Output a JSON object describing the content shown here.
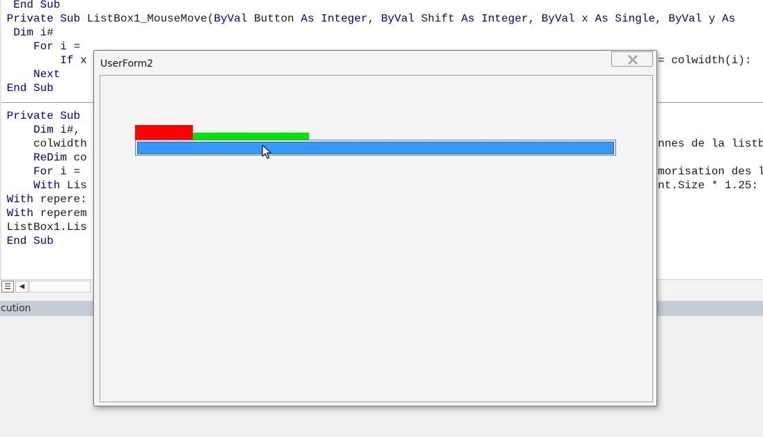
{
  "editor": {
    "code_lines": [
      {
        "segments": [
          {
            "t": "  End Sub",
            "c": "kw"
          }
        ]
      },
      {
        "segments": [
          {
            "t": " Private Sub ",
            "c": "kw"
          },
          {
            "t": "ListBox1_MouseMove(",
            "c": ""
          },
          {
            "t": "ByVal",
            "c": "kw"
          },
          {
            "t": " Button ",
            "c": ""
          },
          {
            "t": "As Integer",
            "c": "kw"
          },
          {
            "t": ", ",
            "c": ""
          },
          {
            "t": "ByVal",
            "c": "kw"
          },
          {
            "t": " Shift ",
            "c": ""
          },
          {
            "t": "As Integer",
            "c": "kw"
          },
          {
            "t": ", ",
            "c": ""
          },
          {
            "t": "ByVal",
            "c": "kw"
          },
          {
            "t": " x ",
            "c": ""
          },
          {
            "t": "As Single",
            "c": "kw"
          },
          {
            "t": ", ",
            "c": ""
          },
          {
            "t": "ByVal",
            "c": "kw"
          },
          {
            "t": " y ",
            "c": ""
          },
          {
            "t": "As",
            "c": "kw"
          }
        ]
      },
      {
        "segments": [
          {
            "t": "  Dim",
            "c": "kw"
          },
          {
            "t": " i#",
            "c": ""
          }
        ]
      },
      {
        "segments": [
          {
            "t": "     For",
            "c": "kw"
          },
          {
            "t": " i = ",
            "c": ""
          }
        ]
      },
      {
        "segments": [
          {
            "t": "         If",
            "c": "kw"
          },
          {
            "t": " x",
            "c": ""
          }
        ]
      },
      {
        "segments": [
          {
            "t": "     Next",
            "c": "kw"
          }
        ]
      },
      {
        "segments": [
          {
            "t": " End Sub",
            "c": "kw"
          }
        ]
      },
      {
        "segments": [
          {
            "t": "",
            "c": ""
          }
        ]
      },
      {
        "segments": [
          {
            "t": " Private Sub",
            "c": "kw"
          }
        ]
      },
      {
        "segments": [
          {
            "t": "     Dim",
            "c": "kw"
          },
          {
            "t": " i#,",
            "c": ""
          }
        ]
      },
      {
        "segments": [
          {
            "t": "     colwidth",
            "c": ""
          }
        ]
      },
      {
        "segments": [
          {
            "t": "     ReDim",
            "c": "kw"
          },
          {
            "t": " co",
            "c": ""
          }
        ]
      },
      {
        "segments": [
          {
            "t": "     For",
            "c": "kw"
          },
          {
            "t": " i = ",
            "c": ""
          }
        ]
      },
      {
        "segments": [
          {
            "t": "     With",
            "c": "kw"
          },
          {
            "t": " Lis",
            "c": ""
          }
        ]
      },
      {
        "segments": [
          {
            "t": " With",
            "c": "kw"
          },
          {
            "t": " repere:",
            "c": ""
          }
        ]
      },
      {
        "segments": [
          {
            "t": " With",
            "c": "kw"
          },
          {
            "t": " reperem",
            "c": ""
          }
        ]
      },
      {
        "segments": [
          {
            "t": " ListBox1.Lis",
            "c": ""
          }
        ]
      },
      {
        "segments": [
          {
            "t": " End Sub",
            "c": "kw"
          }
        ]
      }
    ],
    "right_fragments": [
      {
        "row": 4,
        "text": "= colwidth(i):",
        "c": ""
      },
      {
        "row": 10,
        "text": "nnes de la listb",
        "c": "cm"
      },
      {
        "row": 12,
        "text": "morisation des l",
        "c": "cm"
      },
      {
        "row": 13,
        "text": "nt.Size * 1.25:",
        "c": ""
      }
    ],
    "view_icon": "procedure-view-icon",
    "scroll_left_icon": "arrow-left-icon",
    "exec_label": "cution"
  },
  "userform": {
    "title": "UserForm2",
    "close_icon": "close-x-icon",
    "colors": {
      "marker_red": "#ff0000",
      "marker_green": "#00e600",
      "listbox_selection": "#3399ff"
    }
  },
  "cursor": {
    "icon": "arrow-cursor-icon"
  }
}
